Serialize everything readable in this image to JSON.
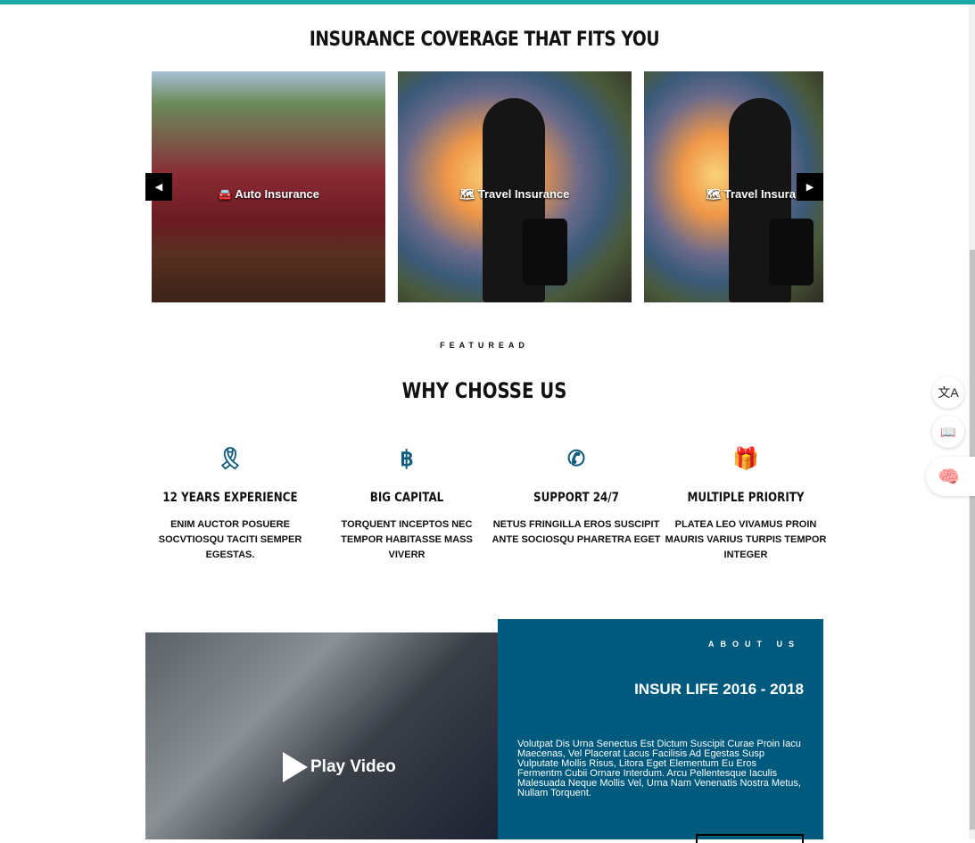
{
  "coverage": {
    "title": "INSURANCE COVERAGE THAT FITS YOU",
    "slides": [
      {
        "label": "Auto Insurance",
        "icon": "car-icon"
      },
      {
        "label": "Travel Insurance",
        "icon": "map-icon"
      },
      {
        "label": "Travel Insurance",
        "icon": "map-icon"
      }
    ],
    "prev_icon": "caret-left-icon",
    "next_icon": "caret-right-icon"
  },
  "why": {
    "eyebrow": "FEATUREAD",
    "title": "WHY CHOSSE US",
    "features": [
      {
        "icon": "award-icon",
        "title": "12 YEARS EXPERIENCE",
        "desc": "ENIM AUCTOR POSUERE SOCVTIOSQU TACITI SEMPER EGESTAS."
      },
      {
        "icon": "bitcoin-icon",
        "title": "BIG CAPITAL",
        "desc": "TORQUENT INCEPTOS NEC TEMPOR HABITASSE MASS VIVERR"
      },
      {
        "icon": "phone-icon",
        "title": "SUPPORT 24/7",
        "desc": "NETUS FRINGILLA EROS SUSCIPIT ANTE SOCIOSQU PHARETRA EGET"
      },
      {
        "icon": "gift-icon",
        "title": "MULTIPLE PRIORITY",
        "desc": "PLATEA LEO VIVAMUS PROIN MAURIS VARIUS TURPIS TEMPOR INTEGER"
      }
    ]
  },
  "video": {
    "label": "Play Video"
  },
  "about": {
    "eyebrow": "ABOUT US",
    "title": "INSUR LIFE 2016 - 2018",
    "text": "Volutpat Dis Urna Senectus Est Dictum Suscipit Curae Proin Iacu Maecenas, Vel Placerat Lacus Facilisis Ad Egestas Susp Vulputate Mollis Risus, Litora Eget Elementum Eu Eros Fermentm Cubii Ornare Interdum. Arcu Pellentesque Iaculis Malesuada Neque Mollis Vel, Urna Nam Venenatis Nostra Metus, Nullam Torquent."
  },
  "colors": {
    "accent": "#1fa8a8",
    "brand": "#005a7d",
    "icon": "#0f5b7c"
  }
}
